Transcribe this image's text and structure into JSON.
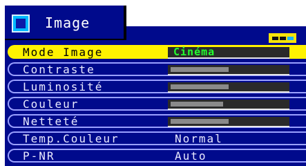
{
  "window": {
    "title": "Image"
  },
  "colors": {
    "panel": "#000a8c",
    "highlight": "#fff200",
    "value_text": "#23ff30"
  },
  "menu": {
    "mode": {
      "label": "Mode Image",
      "value": "Cinéma"
    },
    "contrast": {
      "label": "Contraste",
      "level": 0.5
    },
    "brightness": {
      "label": "Luminosité",
      "level": 0.5
    },
    "color": {
      "label": "Couleur",
      "level": 0.45
    },
    "sharpness": {
      "label": "Netteté",
      "level": 0.5
    },
    "color_temp": {
      "label": "Temp.Couleur",
      "value": "Normal"
    },
    "pnr": {
      "label": "P-NR",
      "value": "Auto"
    }
  }
}
